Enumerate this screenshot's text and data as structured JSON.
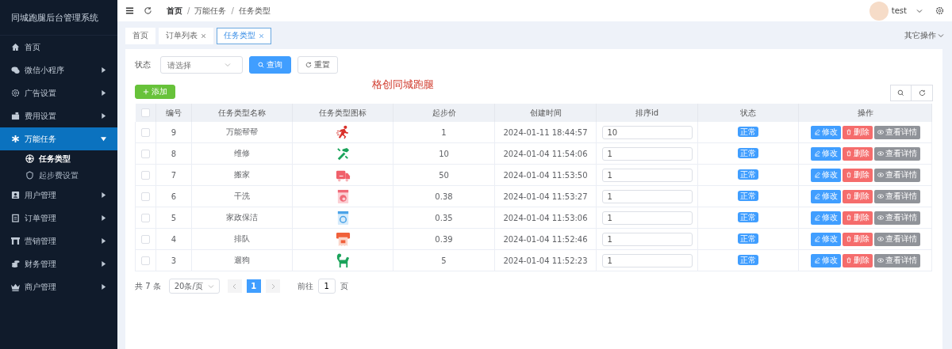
{
  "sidebar": {
    "title": "同城跑腿后台管理系统",
    "items": [
      {
        "label": "首页",
        "expandable": false,
        "selected": false
      },
      {
        "label": "微信小程序",
        "expandable": true,
        "expanded": false,
        "selected": false
      },
      {
        "label": "广告设置",
        "expandable": true,
        "expanded": false,
        "selected": false
      },
      {
        "label": "费用设置",
        "expandable": true,
        "expanded": false,
        "selected": false
      },
      {
        "label": "万能任务",
        "expandable": true,
        "expanded": true,
        "selected": true,
        "children": [
          {
            "label": "任务类型",
            "selected": true
          },
          {
            "label": "起步费设置",
            "selected": false
          }
        ]
      },
      {
        "label": "用户管理",
        "expandable": true,
        "expanded": false,
        "selected": false
      },
      {
        "label": "订单管理",
        "expandable": true,
        "expanded": false,
        "selected": false
      },
      {
        "label": "营销管理",
        "expandable": true,
        "expanded": false,
        "selected": false
      },
      {
        "label": "财务管理",
        "expandable": true,
        "expanded": false,
        "selected": false
      },
      {
        "label": "商户管理",
        "expandable": true,
        "expanded": false,
        "selected": false
      }
    ]
  },
  "header": {
    "breadcrumb": [
      "首页",
      "万能任务",
      "任务类型"
    ],
    "separator": "/",
    "user": "test"
  },
  "tabs": [
    {
      "label": "首页",
      "closable": false,
      "selected": false
    },
    {
      "label": "订单列表",
      "closable": true,
      "selected": false
    },
    {
      "label": "任务类型",
      "closable": true,
      "selected": true
    }
  ],
  "other_actions": "其它操作",
  "filter": {
    "label": "状态",
    "placeholder": "请选择",
    "search_button": "查询",
    "reset_button": "重置"
  },
  "add_button": "添加",
  "banner_text": "格创同城跑腿",
  "table": {
    "header_checked": false,
    "columns": [
      "编号",
      "任务类型名称",
      "任务类型图标",
      "起步价",
      "创建时间",
      "排序id",
      "状态",
      "操作"
    ],
    "rows": [
      {
        "checked": false,
        "id": "9",
        "name": "万能帮帮",
        "price": "1",
        "created": "2024-01-11 18:44:57",
        "sort": "10",
        "status": "正常",
        "actions": [
          "修改",
          "删除",
          "查看详情"
        ]
      },
      {
        "checked": false,
        "id": "8",
        "name": "维修",
        "price": "10",
        "created": "2024-01-04 11:54:06",
        "sort": "1",
        "status": "正常",
        "actions": [
          "修改",
          "删除",
          "查看详情"
        ]
      },
      {
        "checked": false,
        "id": "7",
        "name": "搬家",
        "price": "50",
        "created": "2024-01-04 11:53:50",
        "sort": "1",
        "status": "正常",
        "actions": [
          "修改",
          "删除",
          "查看详情"
        ]
      },
      {
        "checked": false,
        "id": "6",
        "name": "干洗",
        "price": "0.38",
        "created": "2024-01-04 11:53:27",
        "sort": "1",
        "status": "正常",
        "actions": [
          "修改",
          "删除",
          "查看详情"
        ]
      },
      {
        "checked": false,
        "id": "5",
        "name": "家政保洁",
        "price": "0.35",
        "created": "2024-01-04 11:53:06",
        "sort": "1",
        "status": "正常",
        "actions": [
          "修改",
          "删除",
          "查看详情"
        ]
      },
      {
        "checked": false,
        "id": "4",
        "name": "排队",
        "price": "0.39",
        "created": "2024-01-04 11:52:46",
        "sort": "1",
        "status": "正常",
        "actions": [
          "修改",
          "删除",
          "查看详情"
        ]
      },
      {
        "checked": false,
        "id": "3",
        "name": "遛狗",
        "price": "5",
        "created": "2024-01-04 11:52:23",
        "sort": "1",
        "status": "正常",
        "actions": [
          "修改",
          "删除",
          "查看详情"
        ]
      }
    ]
  },
  "pagination": {
    "total": "共 7 条",
    "page_size": "20条/页",
    "pages": [
      {
        "label": "1",
        "selected": true
      }
    ],
    "goto_label": "前往",
    "goto_value": "1",
    "goto_suffix": "页"
  }
}
